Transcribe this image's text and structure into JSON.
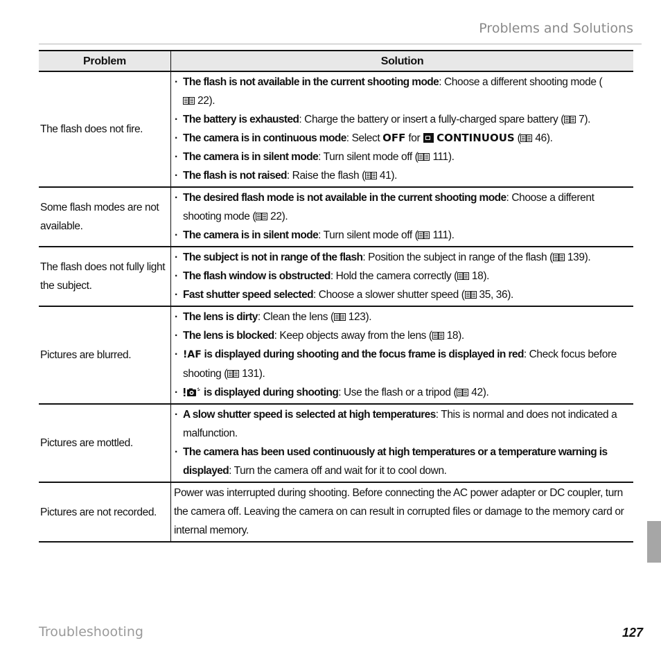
{
  "header": {
    "section_title": "Problems and Solutions"
  },
  "table": {
    "columns": {
      "problem": "Problem",
      "solution": "Solution"
    },
    "rows": [
      {
        "problem": "The flash does not fire.",
        "items": [
          {
            "bold": "The flash is not available in the current shooting mode",
            "text": ": Choose a different shooting mode (",
            "ref": "22",
            "end": ")."
          },
          {
            "bold": "The battery is exhausted",
            "text": ": Charge the battery or insert a fully-charged spare battery (",
            "ref": "7",
            "end": ")."
          },
          {
            "bold": "The camera is in continuous mode",
            "text": ": Select ",
            "ui_off": "OFF",
            "text2": " for ",
            "ui_cont": "CONTINUOUS",
            "text3": " (",
            "ref": "46",
            "end": ")."
          },
          {
            "bold": "The camera is in silent mode",
            "text": ": Turn silent mode off (",
            "ref": "111",
            "end": ")."
          },
          {
            "bold": "The flash is not raised",
            "text": ": Raise the flash (",
            "ref": "41",
            "end": ")."
          }
        ]
      },
      {
        "problem": "Some flash modes are not available.",
        "items": [
          {
            "bold": "The desired flash mode is not available in the current shooting mode",
            "text": ": Choose a different shooting mode (",
            "ref": "22",
            "end": ")."
          },
          {
            "bold": "The camera is in silent mode",
            "text": ": Turn silent mode off (",
            "ref": "111",
            "end": ")."
          }
        ]
      },
      {
        "problem": "The flash does not fully light the subject.",
        "items": [
          {
            "bold": "The subject is not in range of the flash",
            "text": ": Position the subject in range of the flash (",
            "ref": "139",
            "end": ")."
          },
          {
            "bold": "The flash window is obstructed",
            "text": ": Hold the camera correctly (",
            "ref": "18",
            "end": ")."
          },
          {
            "bold": "Fast shutter speed selected",
            "text": ": Choose a slower shutter speed (",
            "ref": "35, 36",
            "end": ")."
          }
        ]
      },
      {
        "problem": "Pictures are blurred.",
        "items": [
          {
            "bold": "The lens is dirty",
            "text": ": Clean the lens (",
            "ref": "123",
            "end": ")."
          },
          {
            "bold": "The lens is blocked",
            "text": ": Keep objects away from the lens (",
            "ref": "18",
            "end": ")."
          },
          {
            "af_icon": "!AF",
            "bold": " is displayed during shooting and the focus frame is displayed in red",
            "text": ": Check focus before shooting (",
            "ref": "131",
            "end": ")."
          },
          {
            "shake_icon": "camera-shake-icon",
            "bold": "is displayed during shooting",
            "text": ": Use the flash or a tripod (",
            "ref": "42",
            "end": ")."
          }
        ]
      },
      {
        "problem": "Pictures are mottled.",
        "items": [
          {
            "bold": "A slow shutter speed is selected at high temperatures",
            "text": ": This is normal and does not indicated a malfunction.",
            "ref": "",
            "end": ""
          },
          {
            "bold": "The camera has been used continuously at high temperatures or a temperature warning is displayed",
            "text": ": Turn the camera off and wait for it to cool down.",
            "ref": "",
            "end": ""
          }
        ]
      },
      {
        "problem": "Pictures are not recorded.",
        "paragraph": "Power was interrupted during shooting.  Before connecting the AC power adapter or DC coupler, turn the camera off.  Leaving the camera on can result in corrupted files or damage to the memory card or internal memory."
      }
    ]
  },
  "footer": {
    "section": "Troubleshooting",
    "page_number": "127"
  },
  "icons": {
    "reference": "book-icon",
    "continuous": "continuous-mode-icon",
    "af_warning": "af-warning-icon",
    "camera_shake": "camera-shake-icon"
  },
  "colors": {
    "header_text": "#8a8a8a",
    "table_header_bg": "#e8e8e8",
    "side_tab": "#a6a6a6"
  }
}
